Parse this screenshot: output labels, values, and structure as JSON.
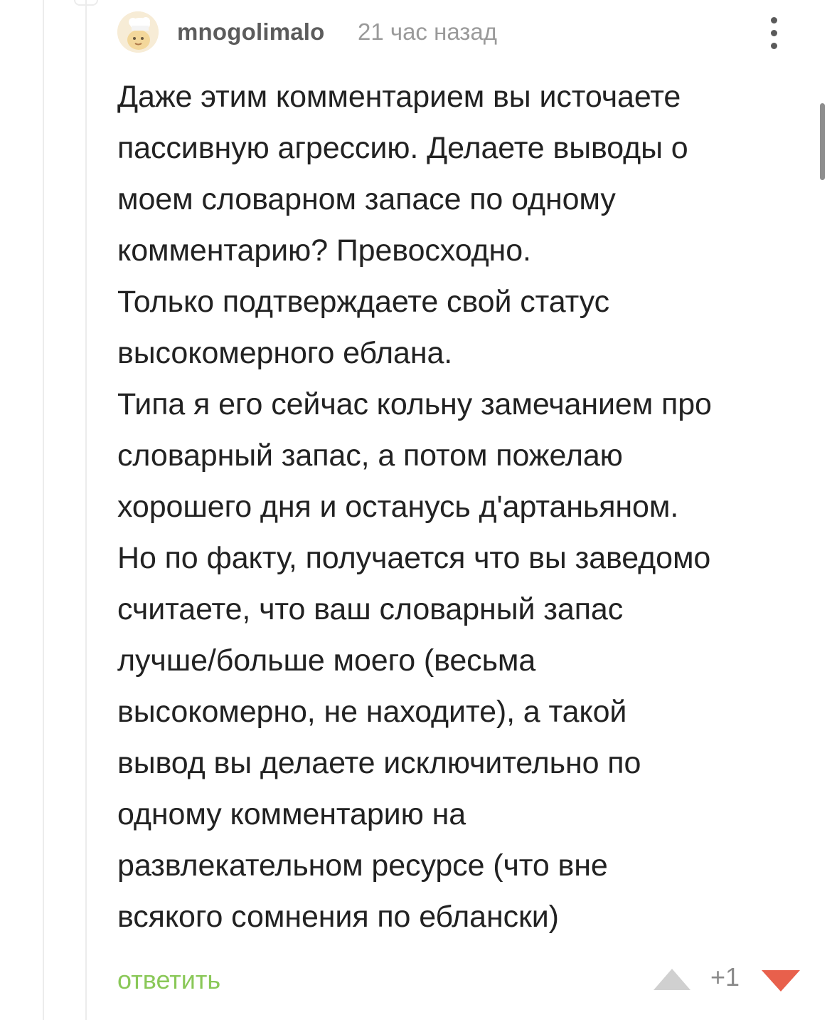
{
  "comment": {
    "author": "mnogolimalo",
    "time": "21 час назад",
    "paragraphs": [
      "Даже этим комментарием вы источаете\nпассивную агрессию. Делаете выводы о\nмоем словарном запасе по одному\nкомментарию? Превосходно.",
      "Только подтверждаете свой статус\nвысокомерного еблана.",
      "Типа я его сейчас кольну замечанием про\nсловарный запас, а потом пожелаю\nхорошего дня и останусь д'артаньяном.",
      "Но по факту, получается что вы заведомо\nсчитаете, что ваш словарный запас\nлучше/больше моего (весьма\nвысокомерно, не находите), а такой\nвывод вы делаете исключительно по\nодному комментарию на\nразвлекательном ресурсе (что вне\nвсякого сомнения по еблански)"
    ],
    "reply_label": "ответить",
    "rating": "+1"
  },
  "icons": {
    "more": "more-vertical-icon",
    "upvote": "upvote-triangle-icon",
    "downvote": "downvote-triangle-icon"
  },
  "colors": {
    "reply": "#8ac858",
    "downvote": "#e8604c",
    "upvote": "#d0d0d0",
    "text": "#222222",
    "username": "#5c5c5c",
    "meta": "#9a9a9a"
  }
}
